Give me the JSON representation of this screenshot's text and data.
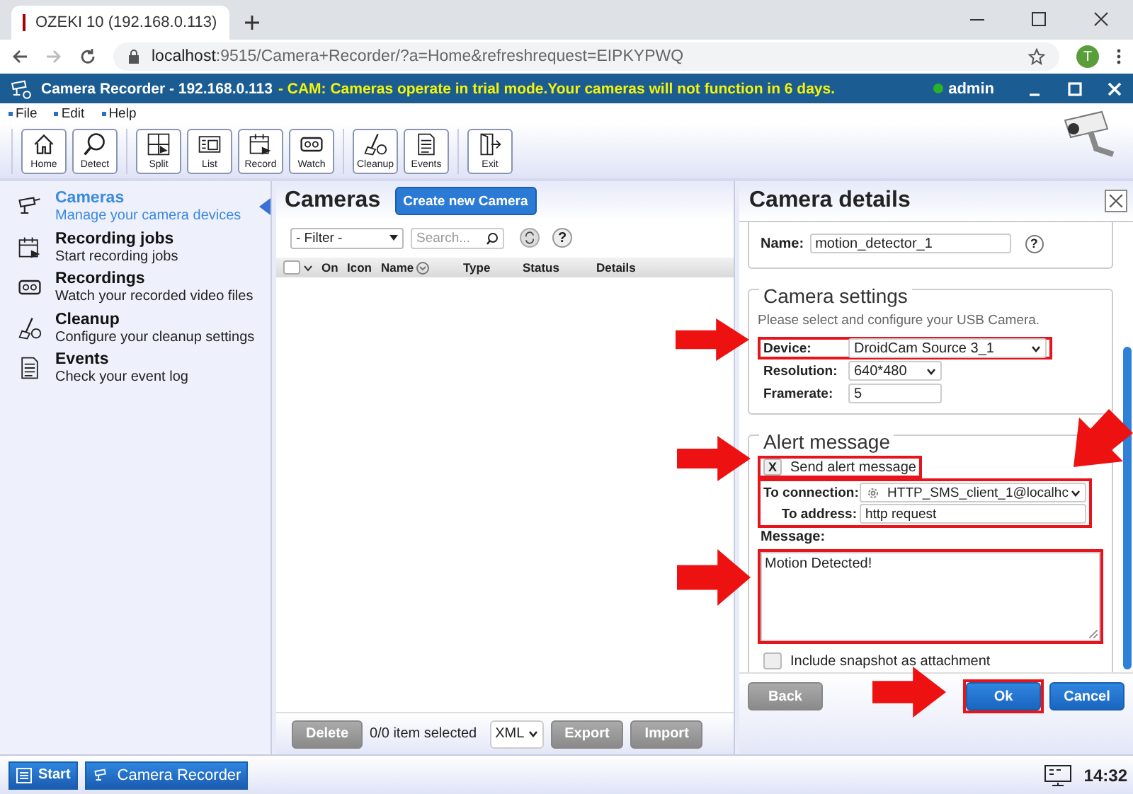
{
  "browser": {
    "tab_title": "OZEKI 10 (192.168.0.113)",
    "url_host": "localhost",
    "url_rest": ":9515/Camera+Recorder/?a=Home&refreshrequest=EIPKYPWQ",
    "avatar": "T"
  },
  "app": {
    "title": "Camera Recorder - 192.168.0.113",
    "notice": " - CAM: Cameras operate in trial mode.Your cameras will not function in 6 days.",
    "user": "admin"
  },
  "menu": [
    "File",
    "Edit",
    "Help"
  ],
  "toolbar": [
    [
      "Home",
      "Detect"
    ],
    [
      "Split",
      "List",
      "Record",
      "Watch"
    ],
    [
      "Cleanup",
      "Events"
    ],
    [
      "Exit"
    ]
  ],
  "sidebar": {
    "items": [
      {
        "title": "Cameras",
        "subtitle": "Manage your camera devices",
        "selected": true
      },
      {
        "title": "Recording jobs",
        "subtitle": "Start recording jobs",
        "selected": false
      },
      {
        "title": "Recordings",
        "subtitle": "Watch your recorded video files",
        "selected": false
      },
      {
        "title": "Cleanup",
        "subtitle": "Configure your cleanup settings",
        "selected": false
      },
      {
        "title": "Events",
        "subtitle": "Check your event log",
        "selected": false
      }
    ]
  },
  "cameras": {
    "title": "Cameras",
    "create_button": "Create new Camera",
    "filter": "- Filter -",
    "search_placeholder": "Search...",
    "help": "?",
    "select_all_checked": false,
    "columns": [
      "On",
      "Icon",
      "Name",
      "Type",
      "Status",
      "Details"
    ],
    "delete_button": "Delete",
    "selection": "0/0 item selected",
    "format": "XML",
    "export_button": "Export",
    "import_button": "Import"
  },
  "details": {
    "title": "Camera details",
    "name_label": "Name:",
    "name_value": "motion_detector_1",
    "help": "?",
    "camera_settings": {
      "legend": "Camera settings",
      "hint": "Please select and configure your USB Camera.",
      "fields": [
        {
          "kind": "select",
          "label": "Device:",
          "value": "DroidCam Source 3_1",
          "highlighted": true
        },
        {
          "kind": "select",
          "label": "Resolution:",
          "value": "640*480"
        },
        {
          "kind": "input",
          "label": "Framerate:",
          "value": "5"
        }
      ]
    },
    "alert": {
      "legend": "Alert message",
      "send_alert": {
        "label": "Send alert message",
        "checked": true,
        "check_mark": "X",
        "highlighted": true
      },
      "recipient": {
        "highlighted": true,
        "connection_label": "To connection:",
        "connection_value": "HTTP_SMS_client_1@localhc",
        "address_label": "To address:",
        "address_value": "http request"
      },
      "message_label": "Message:",
      "message": {
        "value": "Motion Detected!",
        "highlighted": true
      },
      "snapshot": {
        "label": "Include snapshot as attachment",
        "checked": false
      }
    },
    "buttons": [
      {
        "label": "Back",
        "kind": "secondary"
      },
      {
        "label": "Ok",
        "kind": "primary",
        "highlighted": true
      },
      {
        "label": "Cancel",
        "kind": "primary"
      }
    ]
  },
  "taskbar": {
    "start": "Start",
    "app": "Camera Recorder",
    "clock": "14:32"
  }
}
